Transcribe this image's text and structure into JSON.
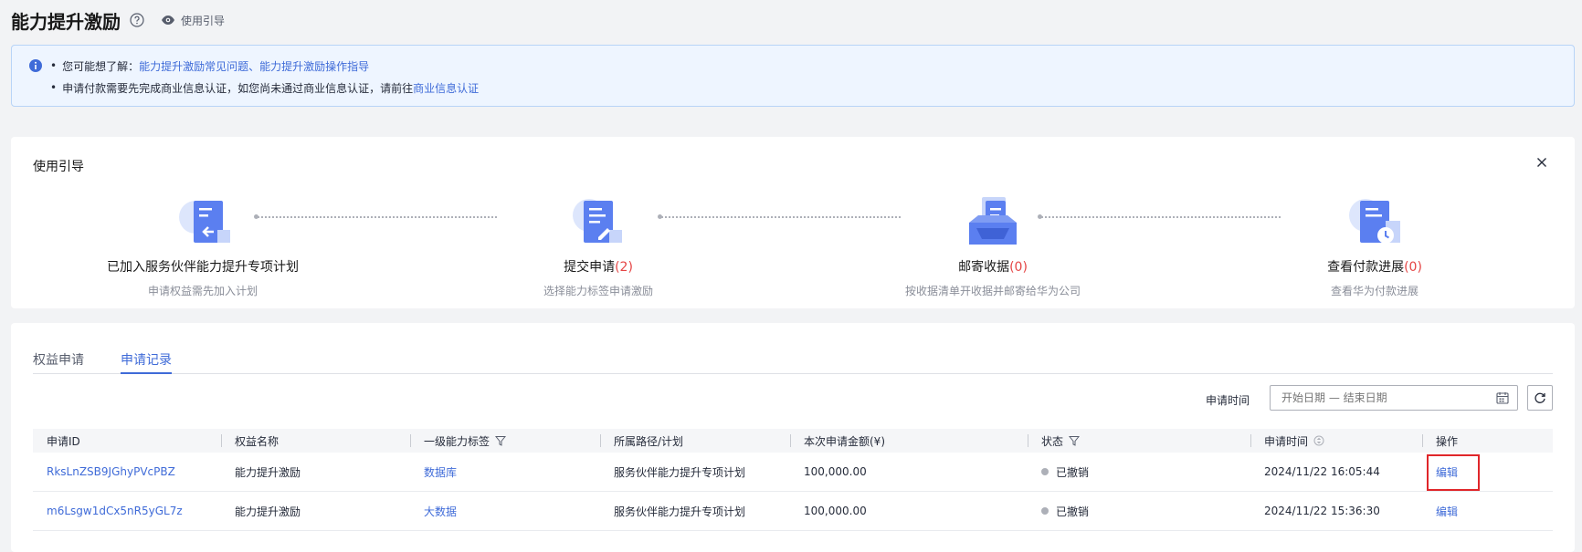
{
  "header": {
    "title": "能力提升激励",
    "guide_link": "使用引导"
  },
  "notice": {
    "line1_prefix": "您可能想了解：",
    "link_faq": "能力提升激励常见问题",
    "separator": "、",
    "link_guide": "能力提升激励操作指导",
    "line2_text": "申请付款需要先完成商业信息认证，如您尚未通过商业信息认证，请前往",
    "link_cert": "商业信息认证"
  },
  "guide": {
    "title": "使用引导",
    "steps": [
      {
        "title": "已加入服务伙伴能力提升专项计划",
        "count": "",
        "desc": "申请权益需先加入计划",
        "icon": "document-return-icon"
      },
      {
        "title": "提交申请",
        "count": "(2)",
        "desc": "选择能力标签申请激励",
        "icon": "document-edit-icon"
      },
      {
        "title": "邮寄收据",
        "count": "(0)",
        "desc": "按收据清单开收据并邮寄给华为公司",
        "icon": "mailbox-icon"
      },
      {
        "title": "查看付款进展",
        "count": "(0)",
        "desc": "查看华为付款进展",
        "icon": "document-clock-icon"
      }
    ]
  },
  "records": {
    "tabs": [
      {
        "label": "权益申请",
        "active": false
      },
      {
        "label": "申请记录",
        "active": true
      }
    ],
    "filter_label": "申请时间",
    "date_placeholder": "开始日期 — 结束日期",
    "columns": [
      "申请ID",
      "权益名称",
      "一级能力标签",
      "所属路径/计划",
      "本次申请金额(¥)",
      "状态",
      "申请时间",
      "操作"
    ],
    "rows": [
      {
        "id": "RksLnZSB9JGhyPVcPBZ",
        "name": "能力提升激励",
        "tag": "数据库",
        "plan": "服务伙伴能力提升专项计划",
        "amount": "100,000.00",
        "status": "已撤销",
        "time": "2024/11/22 16:05:44",
        "action": "编辑"
      },
      {
        "id": "m6Lsgw1dCx5nR5yGL7z",
        "name": "能力提升激励",
        "tag": "大数据",
        "plan": "服务伙伴能力提升专项计划",
        "amount": "100,000.00",
        "status": "已撤销",
        "time": "2024/11/22 15:36:30",
        "action": "编辑"
      }
    ]
  },
  "colors": {
    "link": "#3f6bd8",
    "count_red": "#e54545",
    "highlight": "#e0262a",
    "illus_blue": "#5b7ff0"
  }
}
